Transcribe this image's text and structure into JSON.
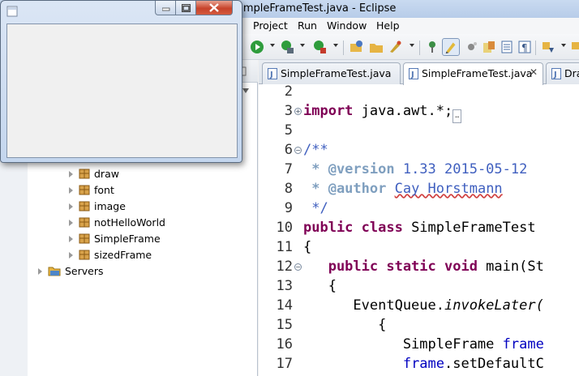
{
  "eclipse": {
    "title": "SimpleFrameTest.java - Eclipse",
    "menu": [
      "Project",
      "Run",
      "Window",
      "Help"
    ]
  },
  "explorer": {
    "items": [
      {
        "label": "draw",
        "icon": "package-icon"
      },
      {
        "label": "font",
        "icon": "package-icon"
      },
      {
        "label": "image",
        "icon": "package-icon"
      },
      {
        "label": "notHelloWorld",
        "icon": "package-icon"
      },
      {
        "label": "SimpleFrame",
        "icon": "package-icon"
      },
      {
        "label": "sizedFrame",
        "icon": "package-icon"
      }
    ],
    "servers_label": "Servers"
  },
  "editor": {
    "tabs": [
      {
        "label": "SimpleFrameTest.java",
        "active": false
      },
      {
        "label": "SimpleFrameTest.java",
        "active": true,
        "close": "✕"
      },
      {
        "label": "Dra",
        "active": false
      }
    ],
    "line_numbers": [
      "2",
      "3",
      "5",
      "6",
      "7",
      "8",
      "9",
      "10",
      "11",
      "12",
      "13",
      "14",
      "15",
      "16",
      "17"
    ],
    "code": {
      "l3_kw": "import",
      "l3_rest": " java.awt.*;",
      "l6": "/**",
      "l7_tag": " * @version",
      "l7_rest": " 1.33 2015-05-12",
      "l8_tag": " * @author",
      "l8_name": "Cay Horstmann",
      "l9": " */",
      "l10_kw": "public class",
      "l10_rest": " SimpleFrameTest",
      "l11": "{",
      "l12_kw": "   public static void",
      "l12_rest": " main(St",
      "l13": "   {",
      "l14_a": "      EventQueue.",
      "l14_b": "invokeLater(",
      "l15": "         {",
      "l16_a": "            SimpleFrame ",
      "l16_b": "frame",
      "l17_a": "            ",
      "l17_b": "frame",
      "l17_c": ".setDefaultC"
    }
  },
  "frame_window": {
    "minimize_icon": "minimize-icon",
    "maximize_icon": "maximize-icon",
    "close_icon": "close-icon"
  },
  "colors": {
    "keyword": "#7f0055",
    "javadoc": "#3f5fbf",
    "javadoc_tag": "#7f9fbf",
    "field": "#0000c0"
  }
}
